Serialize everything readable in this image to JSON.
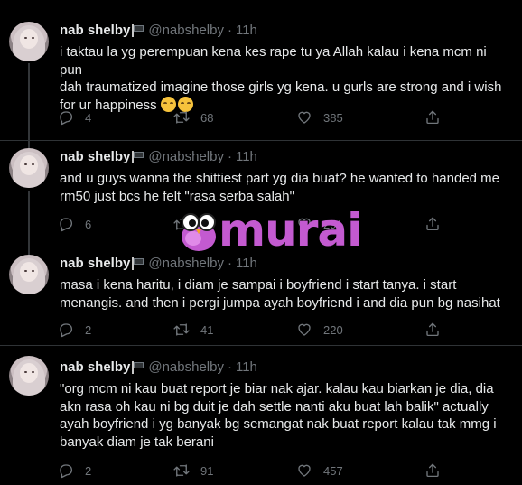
{
  "tweets": [
    {
      "name": "nab shelby",
      "handle": "@nabshelby",
      "time": "11h",
      "text": "i taktau la yg perempuan kena kes rape tu ya Allah kalau i kena mcm ni pun\ndah traumatized imagine those girls yg kena. u gurls are strong and i wish\nfor ur happiness",
      "replies": "4",
      "retweets": "68",
      "likes": "385"
    },
    {
      "name": "nab shelby",
      "handle": "@nabshelby",
      "time": "11h",
      "text": "and u guys wanna the shittiest part yg dia buat? he wanted to handed me\nrm50 just bcs he felt \"rasa serba salah\"",
      "replies": "6",
      "retweets": "",
      "likes": "291"
    },
    {
      "name": "nab shelby",
      "handle": "@nabshelby",
      "time": "11h",
      "text": "masa i kena haritu, i diam je sampai i boyfriend i start tanya. i start\nmenangis. and then i pergi jumpa ayah boyfriend i and dia pun bg nasihat",
      "replies": "2",
      "retweets": "41",
      "likes": "220"
    },
    {
      "name": "nab shelby",
      "handle": "@nabshelby",
      "time": "11h",
      "text": "\"org mcm ni kau buat report je biar nak ajar. kalau kau biarkan je dia, dia\nakn rasa oh kau ni bg duit je dah settle nanti aku buat lah balik\" actually\nayah boyfriend i yg banyak bg semangat nak buat report kalau tak mmg i\nbanyak diam je tak berani",
      "replies": "2",
      "retweets": "91",
      "likes": "457"
    }
  ],
  "watermark": {
    "text": "murai",
    "color": "#c35ad0"
  },
  "icons": {
    "reply": "reply-icon",
    "retweet": "retweet-icon",
    "like": "heart-icon",
    "share": "share-icon",
    "flag": "black-flag-icon",
    "emoji": "relieved-face-emoji"
  },
  "colors": {
    "background": "#000000",
    "text": "#e7e9ea",
    "secondary": "#71767b",
    "divider": "#2f3336"
  }
}
